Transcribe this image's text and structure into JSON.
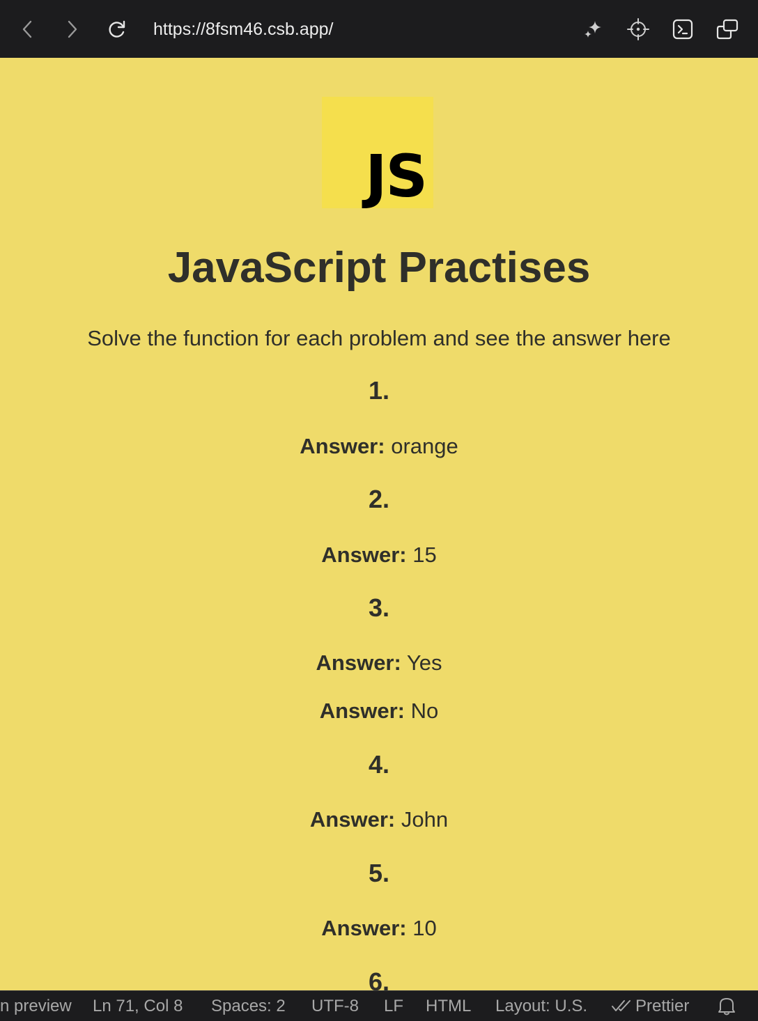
{
  "browser": {
    "url": "https://8fsm46.csb.app/",
    "back_icon": "chevron-left-icon",
    "forward_icon": "chevron-right-icon",
    "reload_icon": "reload-icon",
    "tools": [
      "sparkle-icon",
      "crosshair-icon",
      "terminal-icon",
      "windows-icon"
    ]
  },
  "page": {
    "logo_text": "JS",
    "title": "JavaScript Practises",
    "subtitle": "Solve the function for each problem and see the answer here",
    "answer_label": "Answer:",
    "problems": [
      {
        "number": "1.",
        "answers": [
          "orange"
        ]
      },
      {
        "number": "2.",
        "answers": [
          "15"
        ]
      },
      {
        "number": "3.",
        "answers": [
          "Yes",
          "No"
        ]
      },
      {
        "number": "4.",
        "answers": [
          "John"
        ]
      },
      {
        "number": "5.",
        "answers": [
          "10"
        ]
      },
      {
        "number": "6.",
        "answers": []
      }
    ]
  },
  "statusbar": {
    "preview": "n preview",
    "position": "Ln 71, Col 8",
    "spaces": "Spaces: 2",
    "encoding": "UTF-8",
    "eol": "LF",
    "language": "HTML",
    "layout": "Layout: U.S.",
    "prettier": "Prettier",
    "bell_icon": "bell-icon"
  },
  "colors": {
    "page_bg": "#efdb6a",
    "logo_bg": "#f5df4d",
    "text": "#2f2f2a",
    "chrome_bg": "#1c1c1e"
  }
}
